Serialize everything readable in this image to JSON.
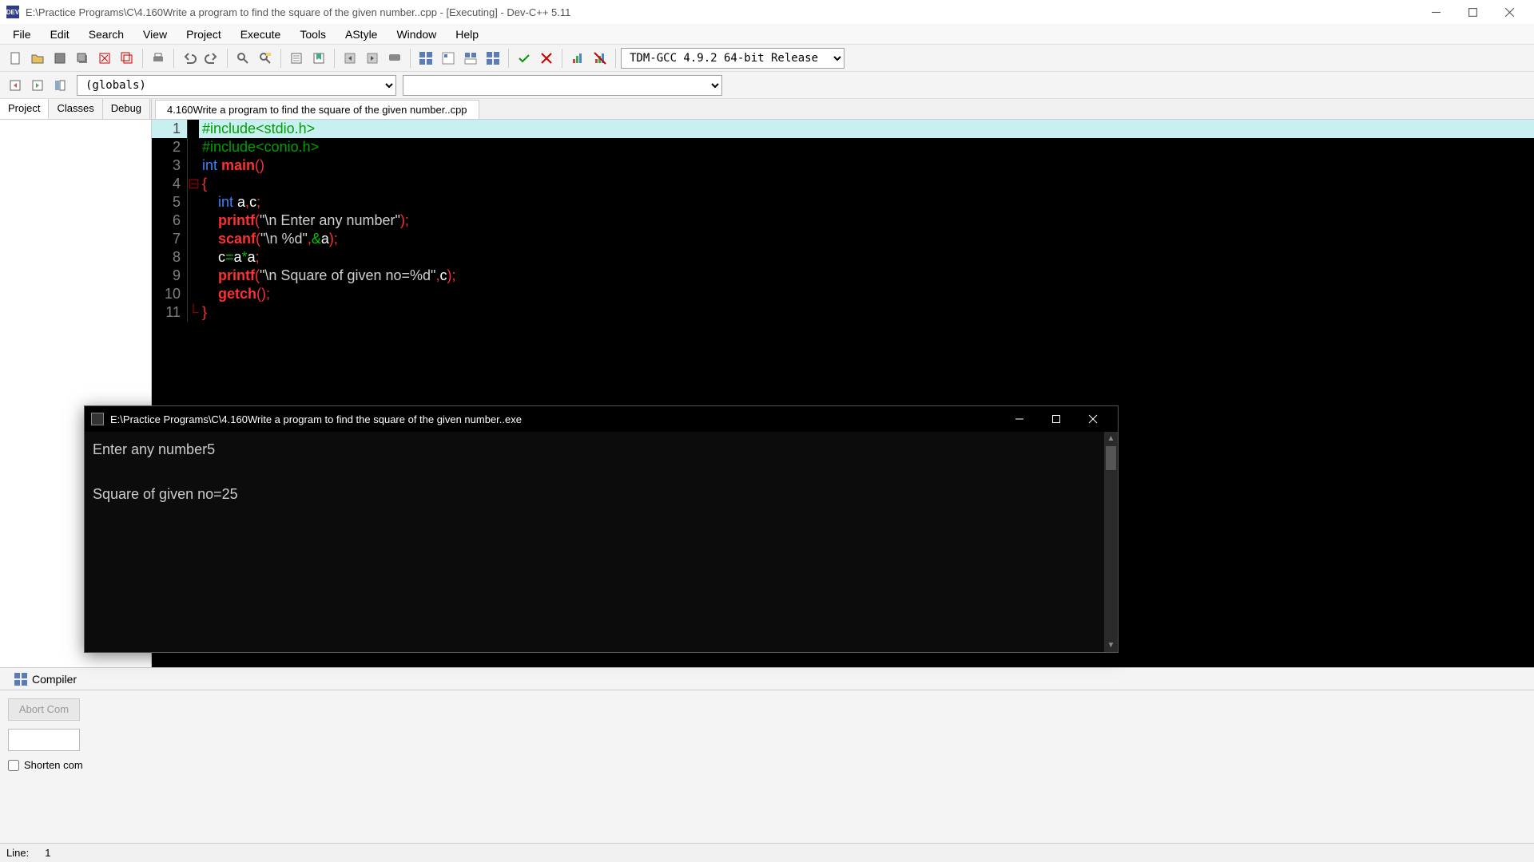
{
  "titlebar": {
    "app_icon_text": "DEV",
    "title": "E:\\Practice Programs\\C\\4.160Write a program to find the square of the given number..cpp - [Executing] - Dev-C++ 5.11"
  },
  "menu": {
    "items": [
      "File",
      "Edit",
      "Search",
      "View",
      "Project",
      "Execute",
      "Tools",
      "AStyle",
      "Window",
      "Help"
    ]
  },
  "toolbar": {
    "compiler_selected": "TDM-GCC 4.9.2 64-bit Release"
  },
  "toolbar2": {
    "scope_selected": "(globals)"
  },
  "sidebar": {
    "tabs": [
      "Project",
      "Classes",
      "Debug"
    ]
  },
  "file_tabs": {
    "active": "4.160Write a program to find the square of the given number..cpp"
  },
  "code": {
    "lines": [
      {
        "n": "1",
        "hl": true,
        "fold": "",
        "tokens": [
          [
            "pre",
            "#include<stdio.h>"
          ]
        ]
      },
      {
        "n": "2",
        "hl": false,
        "fold": "",
        "tokens": [
          [
            "pre",
            "#include<conio.h>"
          ]
        ]
      },
      {
        "n": "3",
        "hl": false,
        "fold": "",
        "tokens": [
          [
            "kw",
            "int "
          ],
          [
            "func",
            "main"
          ],
          [
            "punc",
            "()"
          ]
        ]
      },
      {
        "n": "4",
        "hl": false,
        "fold": "⊟",
        "tokens": [
          [
            "brace",
            "{"
          ]
        ]
      },
      {
        "n": "5",
        "hl": false,
        "fold": "",
        "tokens": [
          [
            "id",
            "    "
          ],
          [
            "kw",
            "int "
          ],
          [
            "id",
            "a"
          ],
          [
            "punc",
            ","
          ],
          [
            "id",
            "c"
          ],
          [
            "punc",
            ";"
          ]
        ]
      },
      {
        "n": "6",
        "hl": false,
        "fold": "",
        "tokens": [
          [
            "id",
            "    "
          ],
          [
            "func",
            "printf"
          ],
          [
            "punc",
            "("
          ],
          [
            "str",
            "\"\\n Enter any number\""
          ],
          [
            "punc",
            ");"
          ]
        ]
      },
      {
        "n": "7",
        "hl": false,
        "fold": "",
        "tokens": [
          [
            "id",
            "    "
          ],
          [
            "func",
            "scanf"
          ],
          [
            "punc",
            "("
          ],
          [
            "str",
            "\"\\n %d\""
          ],
          [
            "punc",
            ","
          ],
          [
            "op",
            "&"
          ],
          [
            "id",
            "a"
          ],
          [
            "punc",
            ");"
          ]
        ]
      },
      {
        "n": "8",
        "hl": false,
        "fold": "",
        "tokens": [
          [
            "id",
            "    c"
          ],
          [
            "op",
            "="
          ],
          [
            "id",
            "a"
          ],
          [
            "op",
            "*"
          ],
          [
            "id",
            "a"
          ],
          [
            "punc",
            ";"
          ]
        ]
      },
      {
        "n": "9",
        "hl": false,
        "fold": "",
        "tokens": [
          [
            "id",
            "    "
          ],
          [
            "func",
            "printf"
          ],
          [
            "punc",
            "("
          ],
          [
            "str",
            "\"\\n Square of given no=%d\""
          ],
          [
            "punc",
            ","
          ],
          [
            "id",
            "c"
          ],
          [
            "punc",
            ");"
          ]
        ]
      },
      {
        "n": "10",
        "hl": false,
        "fold": "",
        "tokens": [
          [
            "id",
            "    "
          ],
          [
            "func",
            "getch"
          ],
          [
            "punc",
            "();"
          ]
        ]
      },
      {
        "n": "11",
        "hl": false,
        "fold": "└",
        "tokens": [
          [
            "brace",
            "}"
          ]
        ]
      }
    ]
  },
  "bottom": {
    "tab_label": "Compiler",
    "abort_label": "Abort Com",
    "shorten_label": "Shorten com"
  },
  "statusbar": {
    "line_label": "Line:",
    "line_value": "1"
  },
  "console": {
    "title": "E:\\Practice Programs\\C\\4.160Write a program to find the square of the given number..exe",
    "line1": "Enter any number5",
    "line2": "Square of given no=25"
  }
}
